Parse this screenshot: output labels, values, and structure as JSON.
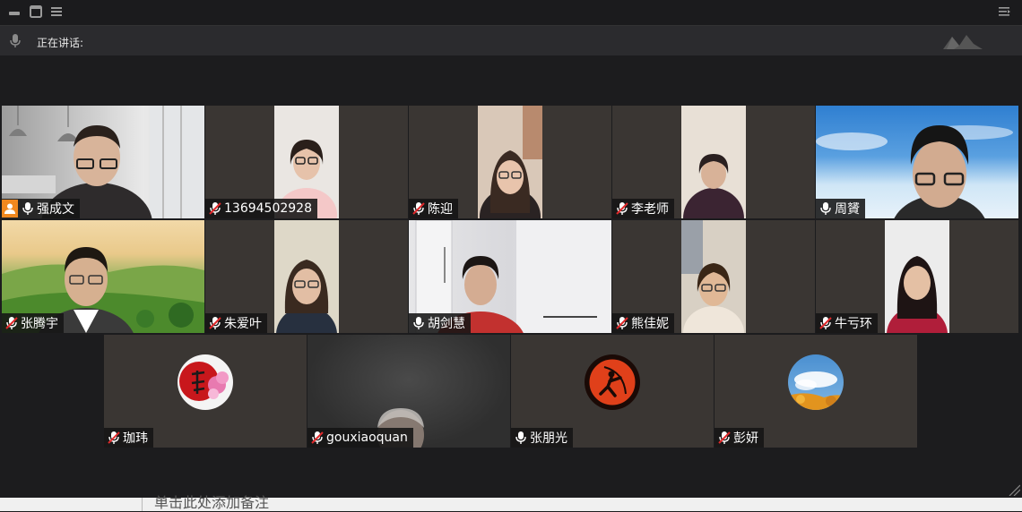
{
  "window": {
    "controls": [
      "minimize-icon",
      "restore-icon",
      "menu-icon",
      "collapse-panel-icon"
    ]
  },
  "speaking": {
    "label": "正在讲话:"
  },
  "participants": [
    {
      "name": "强成文",
      "mic": "on",
      "host": true
    },
    {
      "name": "13694502928",
      "mic": "muted"
    },
    {
      "name": "陈迎",
      "mic": "muted"
    },
    {
      "name": "李老师",
      "mic": "muted"
    },
    {
      "name": "周贇",
      "mic": "on"
    },
    {
      "name": "张腾宇",
      "mic": "muted"
    },
    {
      "name": "朱爱叶",
      "mic": "muted"
    },
    {
      "name": "胡剑慧",
      "mic": "on"
    },
    {
      "name": "熊佳妮",
      "mic": "muted"
    },
    {
      "name": "牛亏环",
      "mic": "muted"
    },
    {
      "name": "珈玮",
      "mic": "muted"
    },
    {
      "name": "gouxiaoquan",
      "mic": "muted"
    },
    {
      "name": "张朋光",
      "mic": "on"
    },
    {
      "name": "彭妍",
      "mic": "muted"
    }
  ],
  "background_text": "单击此处添加备注",
  "colors": {
    "muted_mic": "#e0292b",
    "host_badge": "#f0881f",
    "tile_bg": "#3a3633",
    "tag_bg": "#141414"
  }
}
